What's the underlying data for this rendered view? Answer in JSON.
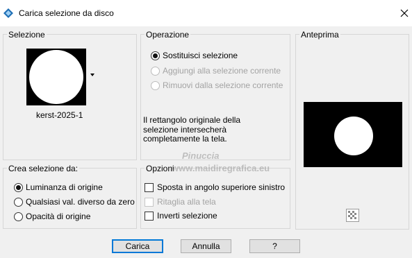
{
  "window": {
    "title": "Carica selezione da disco",
    "icon": "psp-app-icon",
    "close_icon": "close-icon"
  },
  "selezione": {
    "legend": "Selezione",
    "filename": "kerst-2025-1",
    "thumb_icon": "white-circle-on-black"
  },
  "operazione": {
    "legend": "Operazione",
    "options": [
      {
        "label": "Sostituisci selezione",
        "checked": true,
        "enabled": true
      },
      {
        "label": "Aggiungi alla selezione corrente",
        "checked": false,
        "enabled": false
      },
      {
        "label": "Rimuovi dalla selezione corrente",
        "checked": false,
        "enabled": false
      }
    ],
    "description": [
      "Il rettangolo originale della",
      "selezione intersecherà",
      "completamente la tela."
    ]
  },
  "anteprima": {
    "legend": "Anteprima",
    "preview_icon": "white-circle-on-black",
    "toggle_icon": "checker-icon"
  },
  "crea": {
    "legend": "Crea selezione da:",
    "options": [
      {
        "label": "Luminanza di origine",
        "checked": true
      },
      {
        "label": "Qualsiasi val. diverso da zero",
        "checked": false
      },
      {
        "label": "Opacità di origine",
        "checked": false
      }
    ]
  },
  "opzioni": {
    "legend": "Opzioni",
    "checks": [
      {
        "label": "Sposta in angolo superiore sinistro",
        "checked": false,
        "enabled": true
      },
      {
        "label": "Ritaglia alla tela",
        "checked": false,
        "enabled": false
      },
      {
        "label": "Inverti selezione",
        "checked": false,
        "enabled": true
      }
    ]
  },
  "buttons": {
    "ok": "Carica",
    "cancel": "Annulla",
    "help": "?"
  },
  "watermark": {
    "name": "Pinuccia",
    "site": "www.maidiregrafica.eu"
  },
  "colors": {
    "background": "#f0f0f0",
    "accent": "#0078d7"
  }
}
